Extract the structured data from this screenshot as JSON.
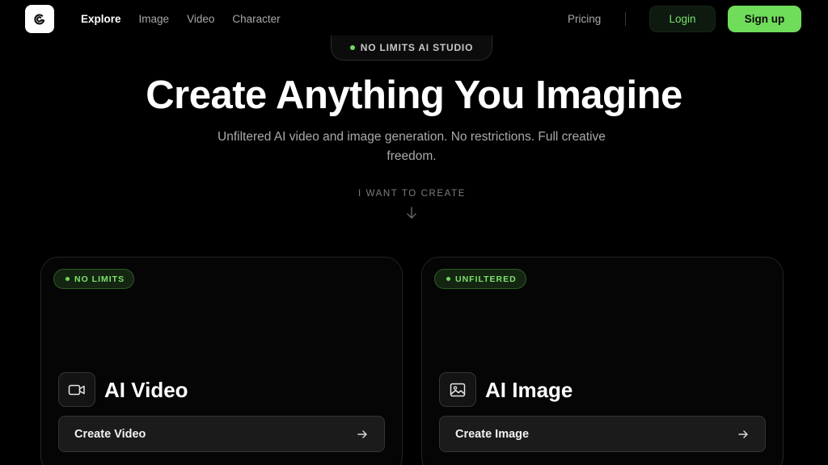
{
  "nav": {
    "logo_icon": "brand-logo-icon",
    "links": [
      {
        "label": "Explore",
        "active": true
      },
      {
        "label": "Image",
        "active": false
      },
      {
        "label": "Video",
        "active": false
      },
      {
        "label": "Character",
        "active": false
      }
    ],
    "pricing_label": "Pricing",
    "login_label": "Login",
    "signup_label": "Sign up"
  },
  "hero": {
    "badge": "NO LIMITS AI STUDIO",
    "title": "Create Anything You Imagine",
    "subtitle": "Unfiltered AI video and image generation. No restrictions. Full creative freedom.",
    "create_prompt": "I WANT TO CREATE",
    "arrow_icon": "arrow-down-icon"
  },
  "cards": [
    {
      "badge": "NO LIMITS",
      "icon": "video-camera-icon",
      "title": "AI Video",
      "cta_label": "Create Video",
      "cta_icon": "arrow-right-icon"
    },
    {
      "badge": "UNFILTERED",
      "icon": "image-icon",
      "title": "AI Image",
      "cta_label": "Create Image",
      "cta_icon": "arrow-right-icon"
    }
  ],
  "colors": {
    "background": "#000000",
    "accent_green": "#6fdc5a",
    "badge_green_text": "#7ee26b",
    "muted_text": "#a9a9a9"
  }
}
